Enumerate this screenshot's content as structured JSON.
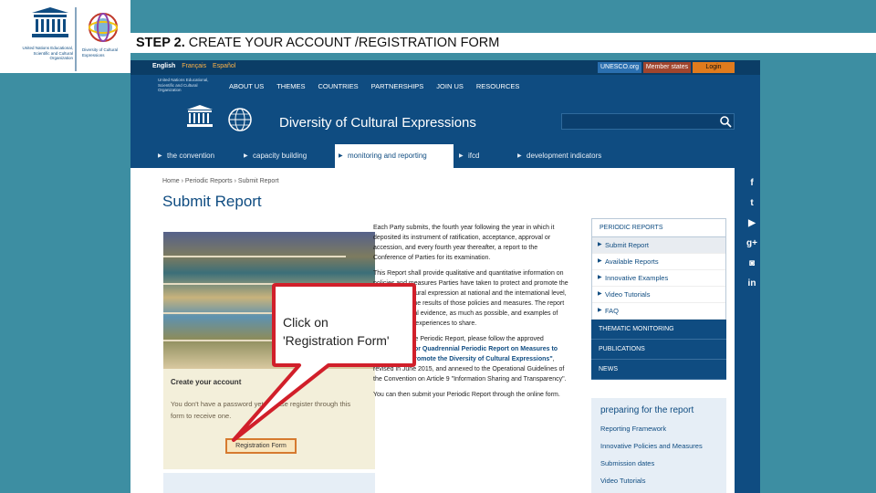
{
  "slide": {
    "title_bold": "STEP 2.",
    "title_rest": " CREATE YOUR ACCOUNT /REGISTRATION FORM",
    "logo_caption_left": "United Nations Educational, Scientific and Cultural Organization",
    "logo_caption_right": "Diversity of Cultural Expressions"
  },
  "topbar": {
    "languages": [
      "English",
      "Français",
      "Español"
    ],
    "buttons": [
      {
        "label": "UNESCO.org"
      },
      {
        "label": "Member states"
      },
      {
        "label": "Login"
      }
    ]
  },
  "nav": {
    "mini_logo_text": "United Nations Educational, Scientific and Cultural Organization",
    "items": [
      "ABOUT US",
      "THEMES",
      "COUNTRIES",
      "PARTNERSHIPS",
      "JOIN US",
      "RESOURCES"
    ]
  },
  "header": {
    "site_title": "Diversity of Cultural Expressions",
    "unesco_mark": "UNESCO"
  },
  "tabs": [
    "the convention",
    "capacity building",
    "monitoring and reporting",
    "ifcd",
    "development indicators"
  ],
  "breadcrumb": "Home  ›  Periodic Reports  ›  Submit Report",
  "page_title": "Submit Report",
  "body": {
    "p1": "Each Party submits, the fourth year following the year in which it deposited its instrument of ratification, acceptance, approval or accession, and every fourth year thereafter, a report to the Conference of Parties for its examination.",
    "p2": "This Report shall provide qualitative and quantitative information on policies and measures Parties have taken to protect and promote the diversity of cultural expression at national and the international level, as well as on the results of those policies and measures. The report based statistical evidence, as much as possible, and examples of measures and experiences to share.",
    "p3_pre": "To complete the Periodic Report, please follow the approved ",
    "p3_link": "\"Framework for Quadrennial Periodic Report on Measures to Protect and Promote the Diversity of Cultural Expressions\"",
    "p3_post": ", revised in June 2015, and annexed to the Operational Guidelines of the Convention on Article 9 \"Information Sharing and Transparency\".",
    "p4": "You can then submit your Periodic Report through the online form."
  },
  "account": {
    "heading": "Create your account",
    "text": "You don't have a password yet. Please register through this form to receive one.",
    "button": "Registration Form"
  },
  "callout": {
    "line1": "Click on",
    "line2": "'Registration Form'"
  },
  "sidebar": {
    "heading": "PERIODIC REPORTS",
    "items": [
      "Submit Report",
      "Available Reports",
      "Innovative Examples",
      "Video Tutorials",
      "FAQ"
    ],
    "sections": [
      "THEMATIC MONITORING",
      "PUBLICATIONS",
      "NEWS"
    ],
    "prep_title": "preparing for the report",
    "prep_items": [
      "Reporting Framework",
      "Innovative Policies and Measures",
      "Submission dates",
      "Video Tutorials"
    ]
  },
  "social_icons": [
    "facebook-icon",
    "twitter-icon",
    "youtube-icon",
    "googleplus-icon",
    "instagram-icon",
    "linkedin-icon"
  ],
  "colors": {
    "brand": "#0f4c81",
    "slide_bg": "#3d8ea2",
    "highlight": "#d67a2f",
    "callout_border": "#d11f2a"
  }
}
